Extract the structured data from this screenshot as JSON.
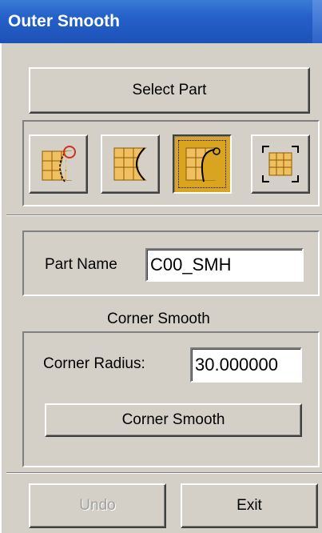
{
  "window": {
    "title": "Outer Smooth"
  },
  "toolbar": {
    "select_part_label": "Select Part"
  },
  "icons": [
    {
      "name": "corner-circle-mode-icon",
      "active": false
    },
    {
      "name": "inner-arc-mode-icon",
      "active": false
    },
    {
      "name": "outer-arc-mode-icon",
      "active": true
    },
    {
      "name": "fit-frame-mode-icon",
      "active": false
    }
  ],
  "part": {
    "label": "Part Name",
    "value": "C00_SMH"
  },
  "corner": {
    "section_title": "Corner Smooth",
    "radius_label": "Corner Radius:",
    "radius_value": "30.000000",
    "smooth_button": "Corner Smooth"
  },
  "footer": {
    "undo_label": "Undo",
    "exit_label": "Exit"
  },
  "colors": {
    "title_bar": "#2460c8",
    "face": "#d4d0c8",
    "icon_fill": "#f0c060",
    "active_icon_bg": "#d9a520"
  }
}
